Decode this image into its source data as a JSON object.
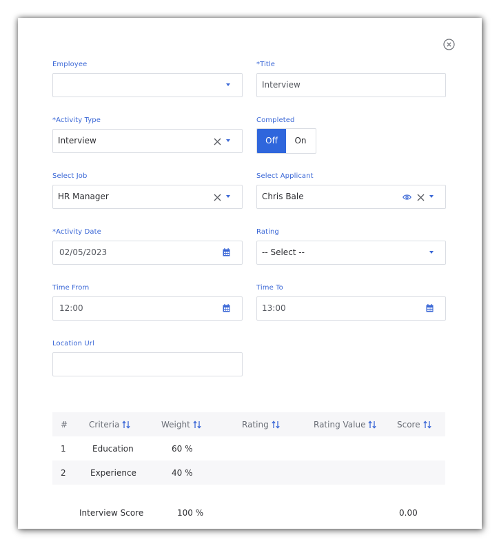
{
  "form": {
    "employee": {
      "label": "Employee",
      "value": ""
    },
    "title": {
      "label": "*Title",
      "value": "Interview"
    },
    "activity_type": {
      "label": "*Activity Type",
      "value": "Interview"
    },
    "completed": {
      "label": "Completed",
      "off_label": "Off",
      "on_label": "On",
      "selected": "Off"
    },
    "select_job": {
      "label": "Select Job",
      "value": "HR Manager"
    },
    "select_applicant": {
      "label": "Select Applicant",
      "value": "Chris Bale"
    },
    "activity_date": {
      "label": "*Activity Date",
      "value": "02/05/2023"
    },
    "rating": {
      "label": "Rating",
      "value": "-- Select --"
    },
    "time_from": {
      "label": "Time From",
      "value": "12:00"
    },
    "time_to": {
      "label": "Time To",
      "value": "13:00"
    },
    "location_url": {
      "label": "Location Url",
      "value": ""
    }
  },
  "criteria_table": {
    "headers": [
      "#",
      "Criteria",
      "Weight",
      "Rating",
      "Rating Value",
      "Score"
    ],
    "rows": [
      {
        "num": "1",
        "criteria": "Education",
        "weight": "60 %",
        "rating": "",
        "rating_value": "",
        "score": ""
      },
      {
        "num": "2",
        "criteria": "Experience",
        "weight": "40 %",
        "rating": "",
        "rating_value": "",
        "score": ""
      }
    ],
    "footer": {
      "label": "Interview Score",
      "weight_total": "100 %",
      "score_total": "0.00"
    }
  },
  "colors": {
    "accent": "#2f66dc",
    "label": "#3a67d6",
    "border": "#dadde3"
  },
  "icons": [
    "close-circle-icon",
    "chevron-down-icon",
    "clear-x-icon",
    "calendar-icon",
    "eye-icon",
    "sort-icon"
  ]
}
